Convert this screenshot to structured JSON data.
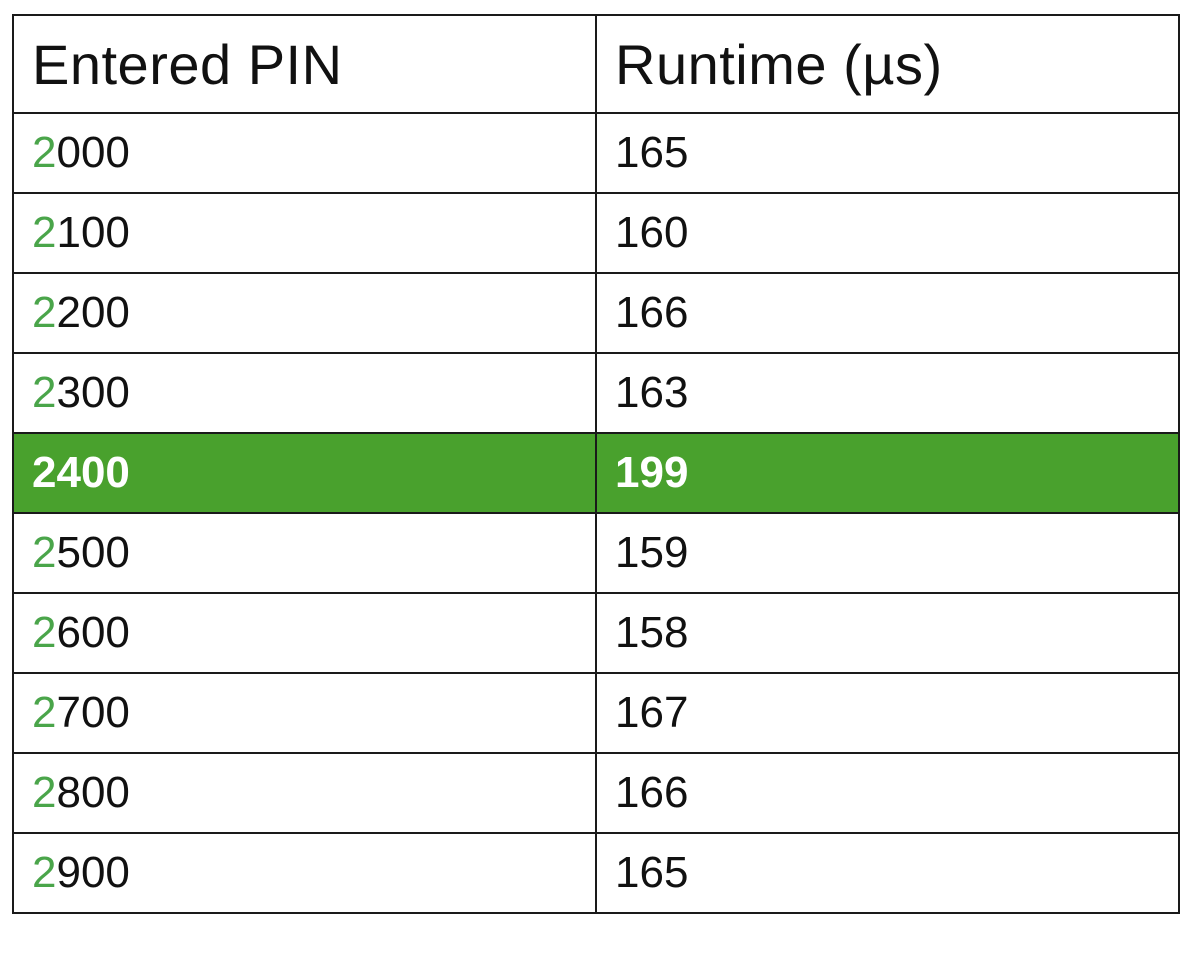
{
  "table": {
    "headers": [
      "Entered PIN",
      "Runtime (µs)"
    ],
    "rows": [
      {
        "pin_first": "2",
        "pin_rest": "000",
        "runtime": "165",
        "highlighted": false
      },
      {
        "pin_first": "2",
        "pin_rest": "100",
        "runtime": "160",
        "highlighted": false
      },
      {
        "pin_first": "2",
        "pin_rest": "200",
        "runtime": "166",
        "highlighted": false
      },
      {
        "pin_first": "2",
        "pin_rest": "300",
        "runtime": "163",
        "highlighted": false
      },
      {
        "pin_first": "2",
        "pin_rest": "400",
        "runtime": "199",
        "highlighted": true
      },
      {
        "pin_first": "2",
        "pin_rest": "500",
        "runtime": "159",
        "highlighted": false
      },
      {
        "pin_first": "2",
        "pin_rest": "600",
        "runtime": "158",
        "highlighted": false
      },
      {
        "pin_first": "2",
        "pin_rest": "700",
        "runtime": "167",
        "highlighted": false
      },
      {
        "pin_first": "2",
        "pin_rest": "800",
        "runtime": "166",
        "highlighted": false
      },
      {
        "pin_first": "2",
        "pin_rest": "900",
        "runtime": "165",
        "highlighted": false
      }
    ]
  },
  "colors": {
    "first_digit": "#4aa54a",
    "highlight_row_bg": "#49a12d",
    "highlight_row_text": "#ffffff",
    "border": "#1a1a1a"
  }
}
